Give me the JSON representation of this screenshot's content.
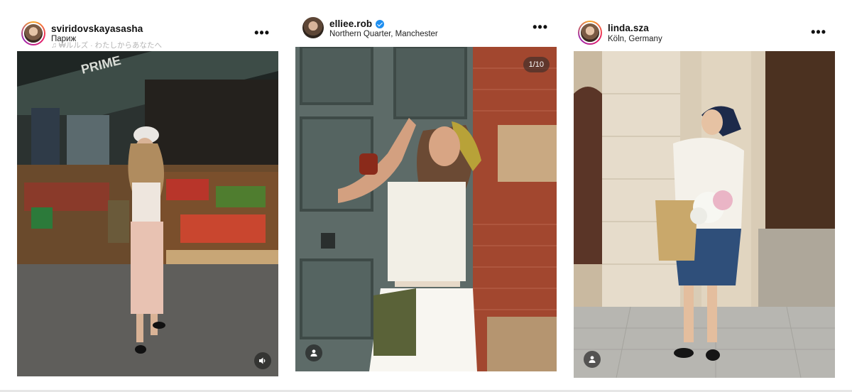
{
  "posts": [
    {
      "username": "sviridovskayasasha",
      "location": "Париж",
      "audio": "♫ ₩ルルズ · わたしからあなたへ",
      "store_sign": "PRIME",
      "verified": false,
      "corner_icon": "speaker-icon"
    },
    {
      "username": "elliee.rob",
      "location": "Northern Quarter, Manchester",
      "verified": true,
      "counter": "1/10",
      "corner_icon": "person-tag-icon"
    },
    {
      "username": "linda.sza",
      "location": "Köln, Germany",
      "verified": false,
      "corner_icon": "person-tag-icon"
    }
  ],
  "more_label": "•••",
  "colors": {
    "verified": "#1f8ff0",
    "header_text": "#111111",
    "subtext": "#b5b5b5"
  }
}
